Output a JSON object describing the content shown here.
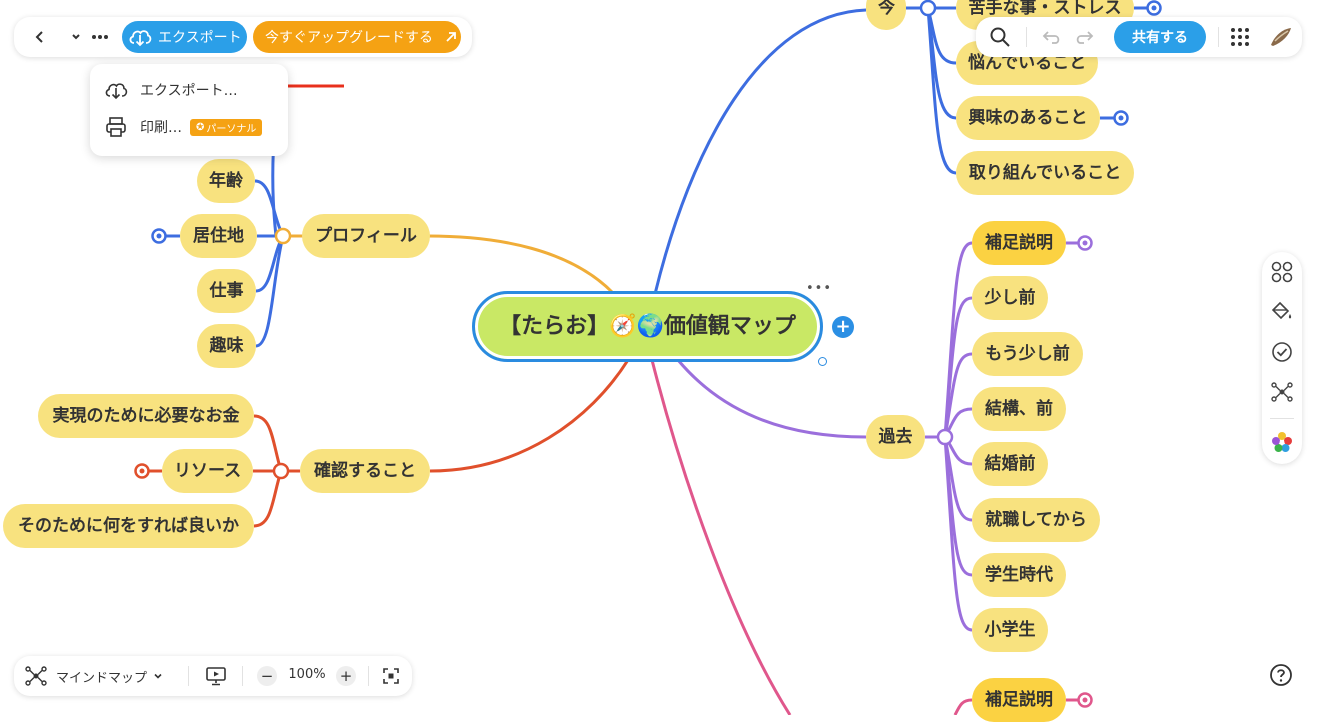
{
  "toolbar": {
    "export_label": "エクスポート",
    "upgrade_label": "今すぐアップグレードする",
    "share_label": "共有する"
  },
  "export_menu": {
    "export_item": "エクスポート…",
    "print_item": "印刷…",
    "print_badge": "パーソナル"
  },
  "bottom_bar": {
    "view_mode": "マインドマップ",
    "zoom": "100%"
  },
  "mindmap": {
    "root": "【たらお】🧭🌍価値観マップ",
    "branches": [
      {
        "label": "今",
        "color": "#3d6de0",
        "children": [
          "苦手な事・ストレス",
          "悩んでいること",
          "興味のあること",
          "取り組んでいること"
        ]
      },
      {
        "label": "プロフィール",
        "color": "#f0ad38",
        "children": [
          "年齢",
          "居住地",
          "仕事",
          "趣味"
        ]
      },
      {
        "label": "確認すること",
        "color": "#e0502c",
        "children": [
          "実現のために必要なお金",
          "リソース",
          "そのために何をすれば良いか"
        ]
      },
      {
        "label": "過去",
        "color": "#9b6fdc",
        "children": [
          "補足説明",
          "少し前",
          "もう少し前",
          "結構、前",
          "結婚前",
          "就職してから",
          "学生時代",
          "小学生"
        ]
      },
      {
        "label": "",
        "color": "#e0578c",
        "children": [
          "補足説明"
        ]
      }
    ]
  },
  "colors": {
    "accent": "#2b9fe8",
    "upgrade": "#f5a213",
    "node": "#f8e27f",
    "node_highlight": "#fbd242",
    "root_fill": "#c9e865",
    "annotation_arrow": "#e8301c"
  }
}
